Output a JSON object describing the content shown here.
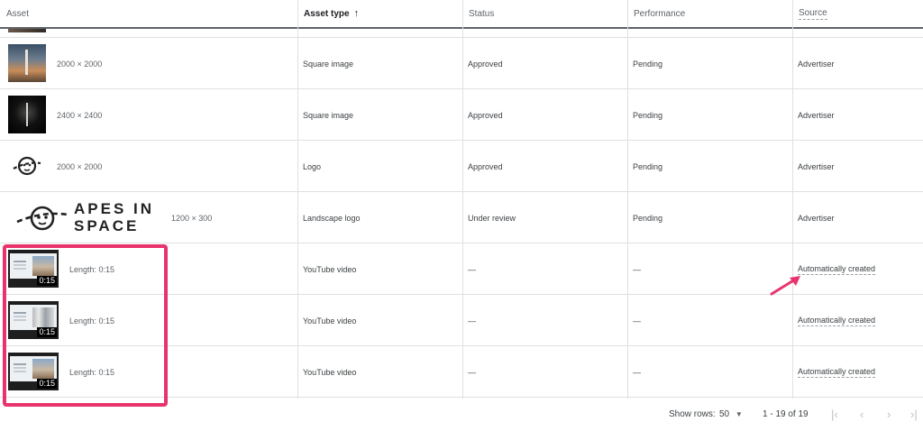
{
  "header": {
    "asset": "Asset",
    "asset_type": "Asset type",
    "status": "Status",
    "performance": "Performance",
    "source": "Source"
  },
  "rows": [
    {
      "dim": "2000 × 2000",
      "type": "Square image",
      "status": "Approved",
      "performance": "Pending",
      "source": "Advertiser",
      "thumb": "rocket-launch-image"
    },
    {
      "dim": "2400 × 2400",
      "type": "Square image",
      "status": "Approved",
      "performance": "Pending",
      "source": "Advertiser",
      "thumb": "rocket-night-image"
    },
    {
      "dim": "2000 × 2000",
      "type": "Logo",
      "status": "Approved",
      "performance": "Pending",
      "source": "Advertiser",
      "thumb": "planet-logo-icon"
    },
    {
      "dim": "1200 × 300",
      "type": "Landscape logo",
      "status": "Under review",
      "performance": "Pending",
      "source": "Advertiser",
      "thumb": "apes-in-space-logo",
      "logo_text_1": "APES IN",
      "logo_text_2": "SPACE"
    },
    {
      "dim": "Length: 0:15",
      "type": "YouTube video",
      "status": "—",
      "performance": "—",
      "source": "Automatically created",
      "duration": "0:15"
    },
    {
      "dim": "Length: 0:15",
      "type": "YouTube video",
      "status": "—",
      "performance": "—",
      "source": "Automatically created",
      "duration": "0:15"
    },
    {
      "dim": "Length: 0:15",
      "type": "YouTube video",
      "status": "—",
      "performance": "—",
      "source": "Automatically created",
      "duration": "0:15"
    }
  ],
  "footer": {
    "show_rows_label": "Show rows:",
    "rows_value": "50",
    "range": "1 - 19 of 19"
  },
  "colors": {
    "highlight": "#e8336d",
    "arrow": "#e8336d"
  }
}
